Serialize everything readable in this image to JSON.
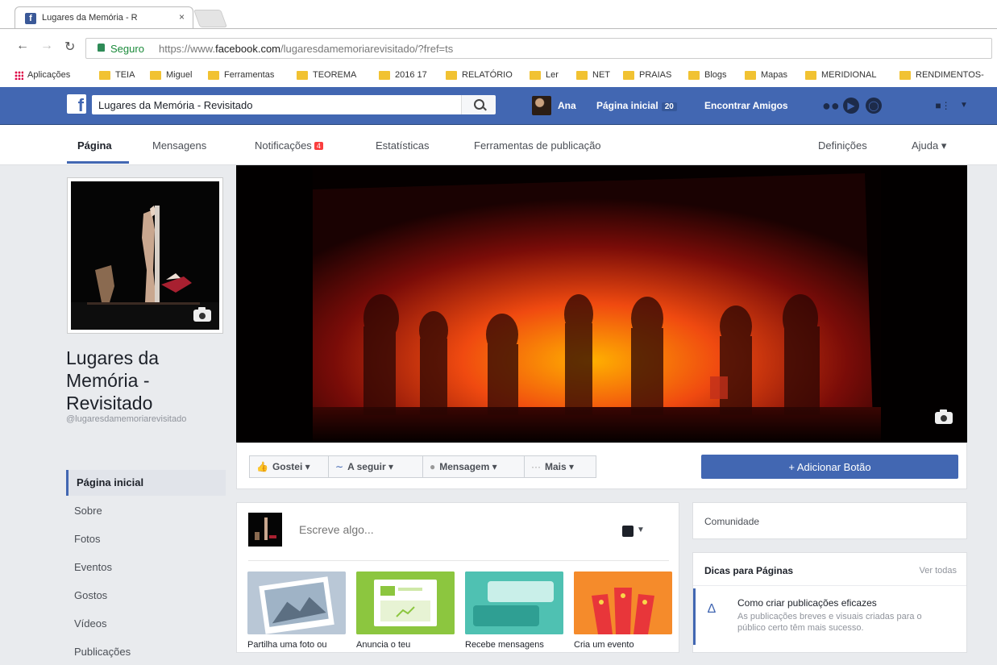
{
  "browser": {
    "tab_title": "Lugares da Memória - R",
    "tab_close": "×",
    "secure_label": "Seguro",
    "url_prefix": "https://www.",
    "url_domain": "facebook.com",
    "url_path": "/lugaresdamemoriarevisitado/?fref=ts",
    "bookmarks": [
      "Aplicações",
      "TEIA",
      "Miguel",
      "Ferramentas",
      "TEOREMA",
      "2016 17",
      "RELATÓRIO",
      "Ler",
      "NET",
      "PRAIAS",
      "Blogs",
      "Mapas",
      "MERIDIONAL",
      "RENDIMENTOS-"
    ]
  },
  "bluebar": {
    "search_value": "Lugares da Memória - Revisitado",
    "user_name": "Ana",
    "home_label": "Página inicial",
    "home_count": "20",
    "find_friends": "Encontrar Amigos"
  },
  "page_nav": {
    "items": [
      "Página",
      "Mensagens",
      "Notificações",
      "Estatísticas",
      "Ferramentas de publicação"
    ],
    "notif_badge": "4",
    "settings": "Definições",
    "help": "Ajuda ▾"
  },
  "page": {
    "name": "Lugares da Memória - Revisitado",
    "handle": "@lugaresdamemoriarevisitado"
  },
  "sidebar": {
    "items": [
      "Página inicial",
      "Sobre",
      "Fotos",
      "Eventos",
      "Gostos",
      "Vídeos",
      "Publicações"
    ]
  },
  "actions": {
    "like": "Gostei ▾",
    "follow": "A seguir ▾",
    "message": "Mensagem ▾",
    "more": "Mais ▾",
    "add_button": "+ Adicionar Botão"
  },
  "composer": {
    "placeholder": "Escreve algo...",
    "cards": [
      "Partilha uma foto ou",
      "Anuncia o teu",
      "Recebe mensagens",
      "Cria um evento"
    ]
  },
  "right": {
    "community": "Comunidade",
    "tips_title": "Dicas para Páginas",
    "see_all": "Ver todas",
    "tip_title": "Como criar publicações eficazes",
    "tip_desc": "As publicações breves e visuais criadas para o público certo têm mais sucesso."
  },
  "colors": {
    "facebook_blue": "#4267b2",
    "badge_red": "#fa3e3e"
  }
}
